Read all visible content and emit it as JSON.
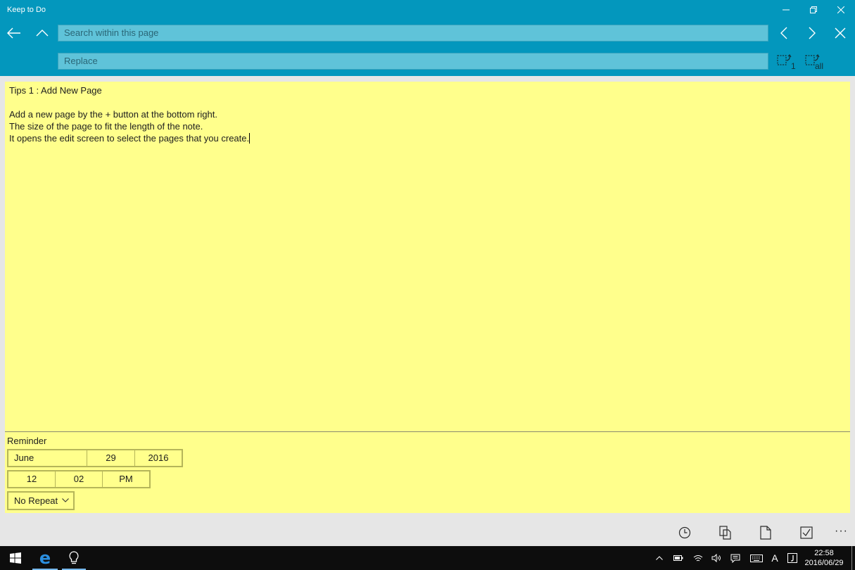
{
  "window": {
    "title": "Keep to Do"
  },
  "search": {
    "placeholder": "Search within this page",
    "value": ""
  },
  "replace": {
    "placeholder": "Replace",
    "value": "",
    "one_sub": "1",
    "all_sub": "all"
  },
  "note": {
    "lines": [
      "Tips 1 : Add New Page",
      "",
      "Add a new page by the + button at the bottom right.",
      "The size of the page to fit the length of the note.",
      "It opens the edit screen to select the pages that you create."
    ],
    "background": "#ffff8c"
  },
  "reminder": {
    "label": "Reminder",
    "month": "June",
    "day": "29",
    "year": "2016",
    "hour": "12",
    "minute": "02",
    "ampm": "PM",
    "repeat": "No Repeat"
  },
  "appbar": {
    "more_label": "···"
  },
  "taskbar": {
    "ime_label": "A",
    "time": "22:58",
    "date": "2016/06/29"
  },
  "colors": {
    "header": "#0397bd",
    "field": "#5fc3d9",
    "note": "#ffff8c",
    "taskbar": "#0d0d0d",
    "accent": "#76b9ed"
  }
}
